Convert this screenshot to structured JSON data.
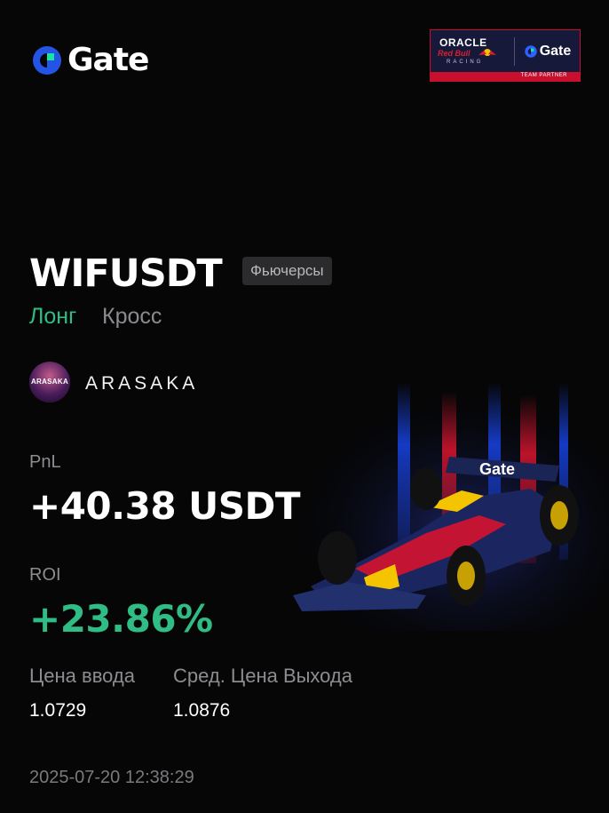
{
  "brand": {
    "name": "Gate",
    "logo_color": "#2354e6",
    "logo_accent": "#17e6a1"
  },
  "partner_badge": {
    "oracle": "ORACLE",
    "red_bull": "Red Bull",
    "racing": "RACING",
    "gate": "Gate",
    "caption": "TEAM PARTNER"
  },
  "position": {
    "pair": "WIFUSDT",
    "tag": "Фьючерсы",
    "side": "Лонг",
    "margin_mode": "Кросс"
  },
  "user": {
    "avatar_text": "ARASAKA",
    "name": "ARASAKA"
  },
  "stats": {
    "pnl_label": "PnL",
    "pnl_value": "+40.38 USDT",
    "roi_label": "ROI",
    "roi_value": "+23.86%",
    "entry_label": "Цена ввода",
    "entry_value": "1.0729",
    "exit_label": "Сред. Цена Выхода",
    "exit_value": "1.0876"
  },
  "timestamp": "2025-07-20 12:38:29",
  "car_livery_text": "Gate",
  "colors": {
    "positive": "#2fbd85",
    "muted": "#8d8d91",
    "badge_red": "#c8102e"
  }
}
